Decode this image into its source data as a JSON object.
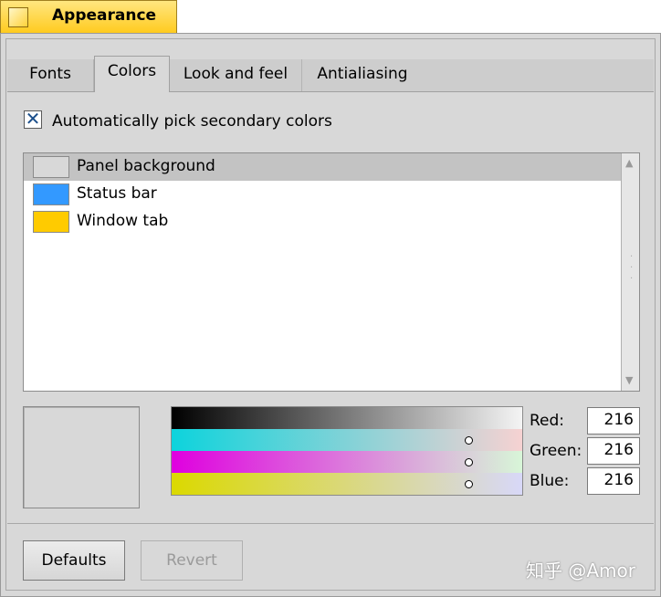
{
  "window": {
    "title": "Appearance"
  },
  "tabs": [
    {
      "label": "Fonts",
      "active": false
    },
    {
      "label": "Colors",
      "active": true
    },
    {
      "label": "Look and feel",
      "active": false
    },
    {
      "label": "Antialiasing",
      "active": false
    }
  ],
  "auto_secondary": {
    "label": "Automatically pick secondary colors",
    "checked": true,
    "mark": "✕"
  },
  "color_items": [
    {
      "label": "Panel background",
      "color": "#d8d8d8",
      "selected": true
    },
    {
      "label": "Status bar",
      "color": "#3399ff",
      "selected": false
    },
    {
      "label": "Window tab",
      "color": "#ffcb00",
      "selected": false
    }
  ],
  "scrollbar": {
    "up": "▲",
    "down": "▼"
  },
  "current_color": {
    "hex": "#d8d8d8"
  },
  "rgb": {
    "red_label": "Red:",
    "red": "216",
    "green_label": "Green:",
    "green": "216",
    "blue_label": "Blue:",
    "blue": "216",
    "slider_fraction": 0.847
  },
  "buttons": {
    "defaults": "Defaults",
    "revert": "Revert"
  },
  "watermark": "知乎 @Amor"
}
